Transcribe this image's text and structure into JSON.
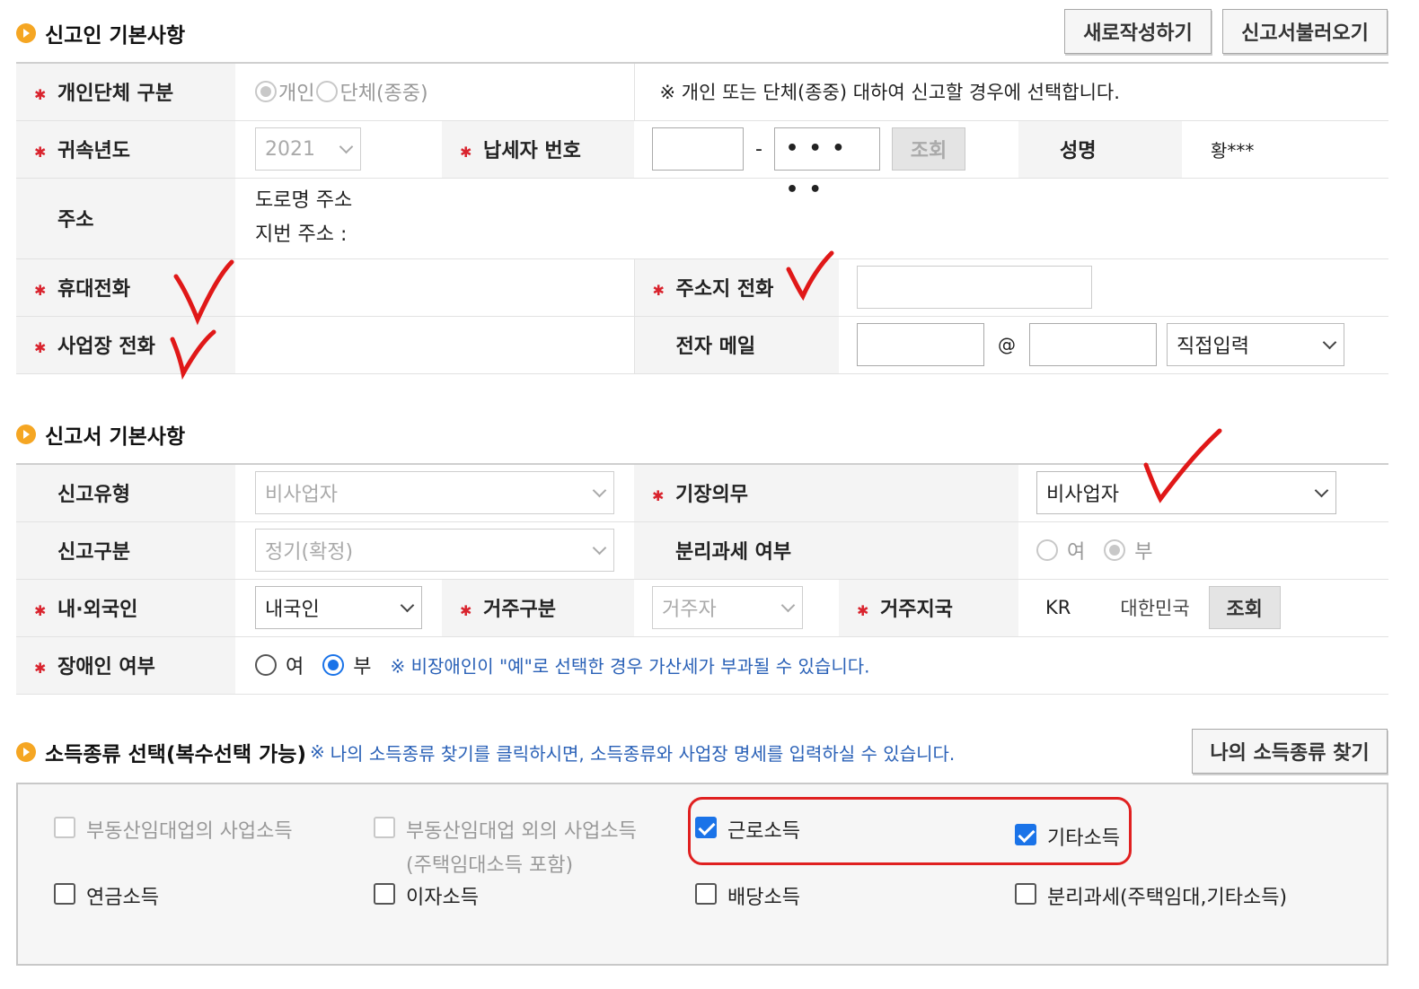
{
  "reporter": {
    "title": "신고인 기본사항",
    "new_button": "새로작성하기",
    "load_button": "신고서불러오기",
    "type_label": "개인단체 구분",
    "type_options": [
      "개인",
      "단체(종중)"
    ],
    "type_note": "※ 개인 또는 단체(종중) 대하여 신고할 경우에 선택합니다.",
    "year_label": "귀속년도",
    "year_value": "2021",
    "taxpayer_no_label": "납세자 번호",
    "taxpayer_dash": "-",
    "taxpayer_masked": "• • • • •",
    "lookup_label": "조회",
    "name_label": "성명",
    "name_value": "황***",
    "address_label": "주소",
    "road_address": "도로명 주소",
    "lot_address": "지번 주소 :",
    "mobile_label": "휴대전화",
    "home_phone_label": "주소지 전화",
    "business_phone_label": "사업장 전화",
    "email_label": "전자 메일",
    "email_at": "@",
    "email_domain_select": "직접입력"
  },
  "report": {
    "title": "신고서 기본사항",
    "report_type_label": "신고유형",
    "report_type_value": "비사업자",
    "bookkeeping_label": "기장의무",
    "bookkeeping_value": "비사업자",
    "category_label": "신고구분",
    "category_value": "정기(확정)",
    "separate_tax_label": "분리과세 여부",
    "separate_tax_yes": "여",
    "separate_tax_no": "부",
    "nationality_label": "내·외국인",
    "nationality_value": "내국인",
    "residence_label": "거주구분",
    "residence_value": "거주자",
    "residence_country_label": "거주지국",
    "country_code": "KR",
    "country_name": "대한민국",
    "country_lookup": "조회",
    "disabled_label": "장애인 여부",
    "disabled_yes": "여",
    "disabled_no": "부",
    "disabled_note": "※ 비장애인이 \"예\"로 선택한 경우 가산세가 부과될 수 있습니다."
  },
  "income": {
    "title": "소득종류 선택(복수선택 가능)",
    "note_mark": "※",
    "note": "나의 소득종류 찾기를 클릭하시면, 소득종류와 사업장 명세를 입력하실 수 있습니다.",
    "find_button": "나의 소득종류 찾기",
    "items": [
      {
        "label": "부동산임대업의 사업소득",
        "sub": "",
        "checked": false,
        "disabled": true
      },
      {
        "label": "부동산임대업 외의 사업소득",
        "sub": "(주택임대소득 포함)",
        "checked": false,
        "disabled": true
      },
      {
        "label": "근로소득",
        "sub": "",
        "checked": true,
        "disabled": false
      },
      {
        "label": "기타소득",
        "sub": "",
        "checked": true,
        "disabled": false
      },
      {
        "label": "연금소득",
        "sub": "",
        "checked": false,
        "disabled": false
      },
      {
        "label": "이자소득",
        "sub": "",
        "checked": false,
        "disabled": false
      },
      {
        "label": "배당소득",
        "sub": "",
        "checked": false,
        "disabled": false
      },
      {
        "label": "분리과세(주택임대,기타소득)",
        "sub": "",
        "checked": false,
        "disabled": false
      }
    ]
  },
  "colors": {
    "accent_blue": "#1a73e8",
    "note_blue": "#2a61b7",
    "required_red": "#d9232d",
    "highlight_red": "#e02020",
    "bullet_orange": "#f5a623"
  }
}
